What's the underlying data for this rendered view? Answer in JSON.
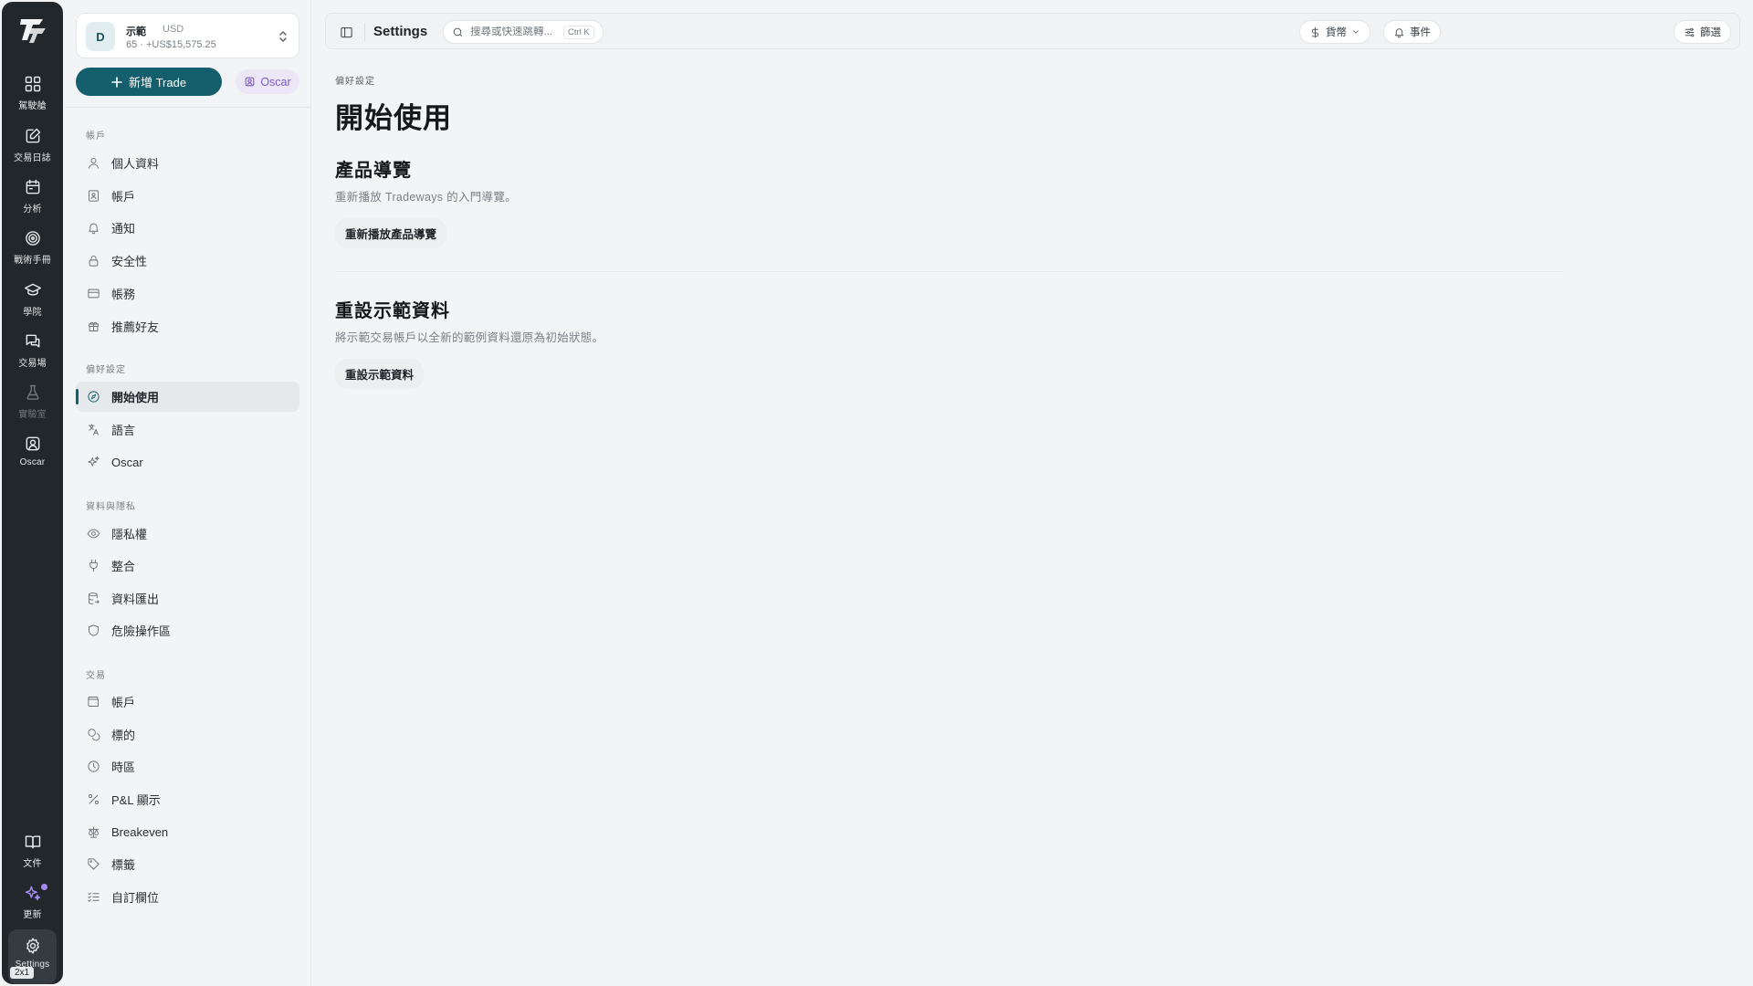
{
  "rail": {
    "items": [
      {
        "label": "駕駛艙",
        "icon": "dashboard-icon"
      },
      {
        "label": "交易日誌",
        "icon": "journal-edit-icon"
      },
      {
        "label": "分析",
        "icon": "calendar-icon"
      },
      {
        "label": "戰術手冊",
        "icon": "target-icon"
      },
      {
        "label": "學院",
        "icon": "graduation-cap-icon"
      },
      {
        "label": "交易場",
        "icon": "chat-bubbles-icon"
      },
      {
        "label": "實驗室",
        "icon": "flask-icon"
      },
      {
        "label": "Oscar",
        "icon": "oscar-portrait-icon"
      }
    ],
    "bottom": [
      {
        "label": "文件",
        "icon": "book-icon"
      },
      {
        "label": "更新",
        "icon": "sparkles-icon"
      },
      {
        "label": "Settings",
        "icon": "gear-icon"
      }
    ],
    "shortcut_badge": "2x1"
  },
  "account": {
    "avatar": "D",
    "name": "示範",
    "currency": "USD",
    "balance": "65 · +US$15,575.25"
  },
  "actions": {
    "new_trade": "新增 Trade",
    "oscar": "Oscar"
  },
  "sidebar": {
    "sections": [
      {
        "title": "帳戶",
        "items": [
          "個人資料",
          "帳戶",
          "通知",
          "安全性",
          "帳務",
          "推薦好友"
        ]
      },
      {
        "title": "偏好設定",
        "items": [
          "開始使用",
          "語言",
          "Oscar"
        ]
      },
      {
        "title": "資料與隱私",
        "items": [
          "隱私權",
          "整合",
          "資料匯出",
          "危險操作區"
        ]
      },
      {
        "title": "交易",
        "items": [
          "帳戶",
          "標的",
          "時區",
          "P&L 顯示",
          "Breakeven",
          "標籤",
          "自訂欄位"
        ]
      }
    ],
    "active_item": "開始使用"
  },
  "topbar": {
    "title": "Settings",
    "search_placeholder": "搜尋或快速跳轉...",
    "search_shortcut": "Ctrl K",
    "currency": "貨幣",
    "events": "事件",
    "filter": "篩選"
  },
  "main": {
    "breadcrumb": "偏好設定",
    "title": "開始使用",
    "tour": {
      "heading": "產品導覽",
      "description": "重新播放 Tradeways 的入門導覽。",
      "button": "重新播放產品導覽"
    },
    "reset": {
      "heading": "重設示範資料",
      "description": "將示範交易帳戶以全新的範例資料還原為初始狀態。",
      "button": "重設示範資料"
    }
  }
}
